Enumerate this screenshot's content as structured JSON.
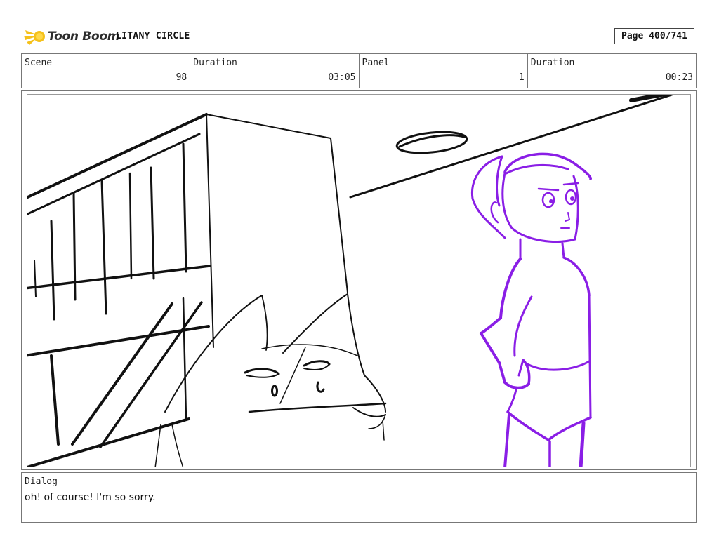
{
  "header": {
    "logo_text": "Toon Boom",
    "project_title": "LITANY CIRCLE",
    "page_indicator": "Page 400/741"
  },
  "info": {
    "scene_label": "Scene",
    "scene_value": "98",
    "scene_duration_label": "Duration",
    "scene_duration_value": "03:05",
    "panel_label": "Panel",
    "panel_value": "1",
    "panel_duration_label": "Duration",
    "panel_duration_value": "00:23"
  },
  "dialog": {
    "label": "Dialog",
    "text": "oh! of course! I'm so sorry."
  },
  "colors": {
    "sketch_black": "#111111",
    "character_purple": "#8a1ee6",
    "logo_yellow": "#f5c11a"
  },
  "icons": {
    "logo": "toon-boom-comet-icon"
  }
}
